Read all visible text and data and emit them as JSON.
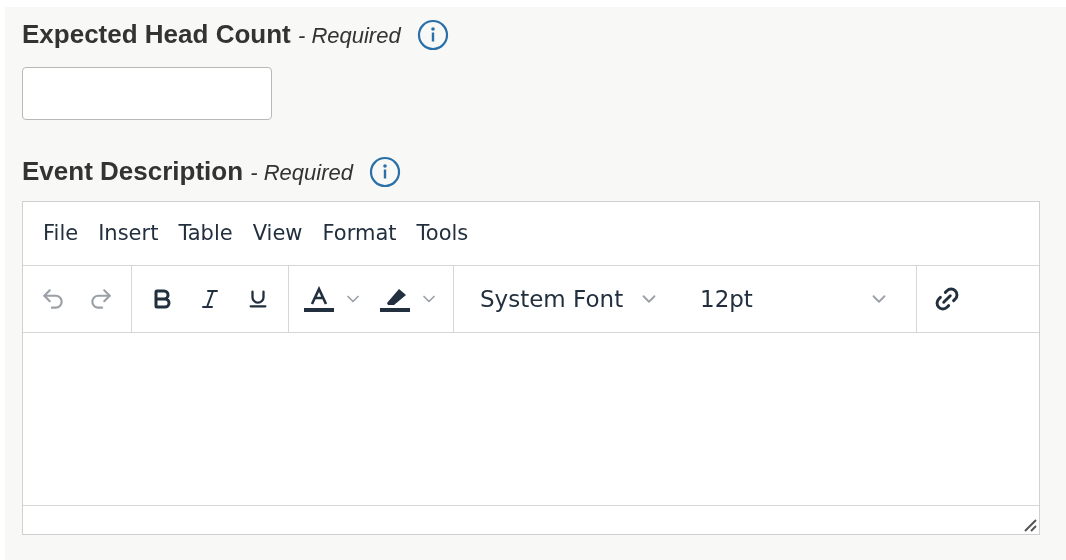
{
  "fields": [
    {
      "kind": "input",
      "label": "Expected Head Count",
      "note": "- Required"
    },
    {
      "kind": "editor",
      "label": "Event Description",
      "note": "- Required"
    }
  ],
  "editor": {
    "menu": [
      "File",
      "Insert",
      "Table",
      "View",
      "Format",
      "Tools"
    ],
    "toolbar_groups": [
      [
        {
          "kind": "undo",
          "disabled": true
        },
        {
          "kind": "redo",
          "disabled": true
        }
      ],
      [
        {
          "kind": "bold",
          "disabled": false
        },
        {
          "kind": "italic",
          "disabled": false
        },
        {
          "kind": "underline",
          "disabled": false
        }
      ],
      [
        {
          "kind": "text-color",
          "disabled": false
        },
        {
          "kind": "highlight",
          "disabled": false
        }
      ],
      [
        {
          "kind": "font-family",
          "value": "System Font"
        },
        {
          "kind": "font-size",
          "value": "12pt"
        }
      ],
      [
        {
          "kind": "link",
          "disabled": false
        }
      ]
    ]
  }
}
